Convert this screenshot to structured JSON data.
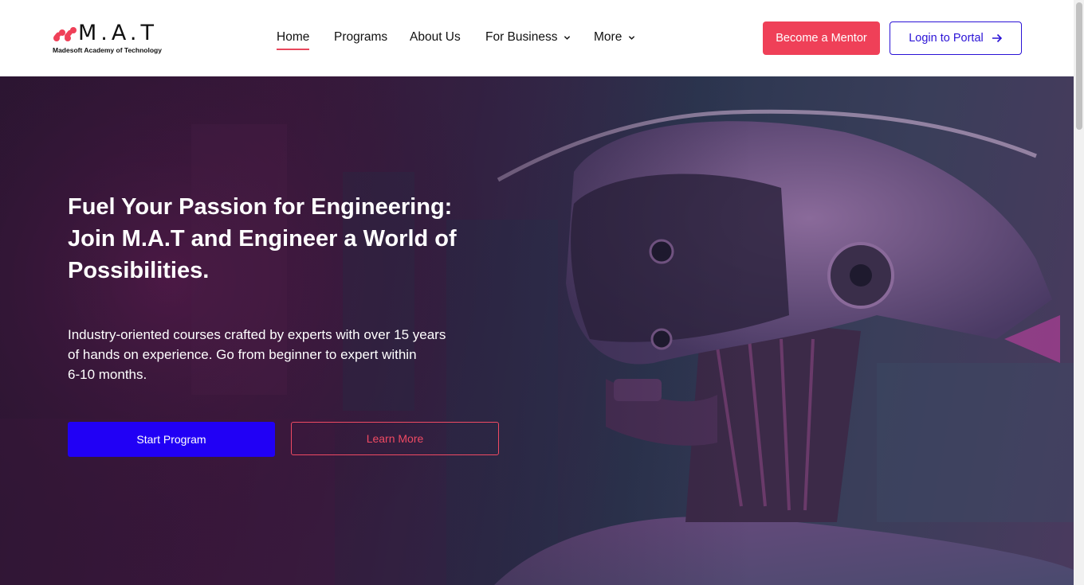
{
  "brand": {
    "name": "M.A.T",
    "tagline": "Madesoft Academy of Technology",
    "accent": "#ef4058",
    "primary": "#2100f5"
  },
  "nav": {
    "items": [
      {
        "label": "Home",
        "active": true,
        "dropdown": false
      },
      {
        "label": "Programs",
        "active": false,
        "dropdown": false
      },
      {
        "label": "About Us",
        "active": false,
        "dropdown": false
      },
      {
        "label": "For Business",
        "active": false,
        "dropdown": true
      },
      {
        "label": "More",
        "active": false,
        "dropdown": true
      }
    ]
  },
  "header": {
    "mentor_label": "Become a Mentor",
    "login_label": "Login to Portal",
    "login_icon": "arrow-right-icon"
  },
  "hero": {
    "title_line1": "Fuel Your Passion for Engineering:",
    "title_line2": "Join M.A.T and Engineer a World of",
    "title_line3": "Possibilities.",
    "desc_line1": "Industry-oriented courses crafted by experts with over 15 years",
    "desc_line2": "of hands on experience. Go from beginner to expert within",
    "desc_line3": "6-10 months.",
    "start_label": "Start Program",
    "learn_label": "Learn More"
  }
}
